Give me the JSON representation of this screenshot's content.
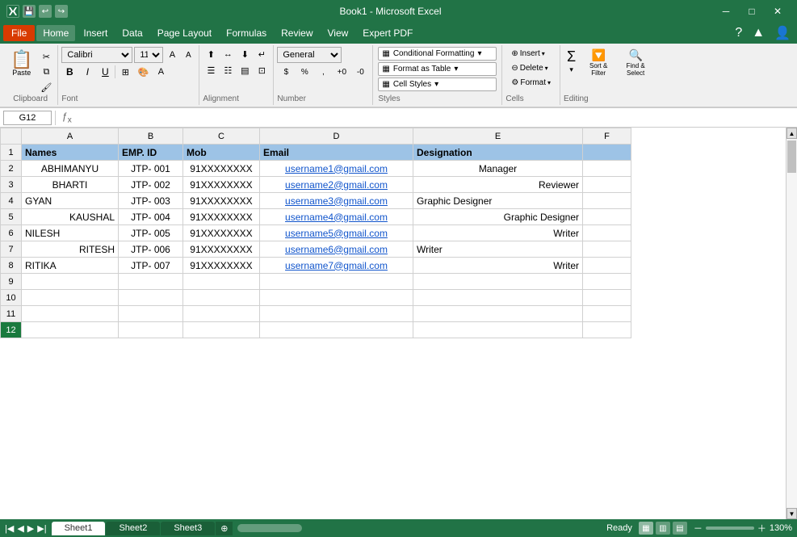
{
  "titleBar": {
    "title": "Book1 - Microsoft Excel",
    "minimize": "─",
    "maximize": "□",
    "close": "✕"
  },
  "menuBar": {
    "file": "File",
    "items": [
      "Home",
      "Insert",
      "Data",
      "Page Layout",
      "Formulas",
      "Review",
      "View",
      "Expert PDF"
    ]
  },
  "ribbon": {
    "clipboard": {
      "label": "Clipboard",
      "paste": "Paste",
      "cut": "✂",
      "copy": "⧉",
      "format_painter": "🖌"
    },
    "font": {
      "label": "Font",
      "name": "Calibri",
      "size": "11",
      "bold": "B",
      "italic": "I",
      "underline": "U",
      "increase": "A",
      "decrease": "A"
    },
    "alignment": {
      "label": "Alignment"
    },
    "number": {
      "label": "Number",
      "format": "General"
    },
    "styles": {
      "label": "Styles",
      "conditional": "Conditional Formatting",
      "format_as_table": "Format as Table",
      "cell_styles": "Cell Styles"
    },
    "cells": {
      "label": "Cells",
      "insert": "Insert",
      "delete": "Delete",
      "format": "Format"
    },
    "editing": {
      "label": "Editing",
      "autosum": "Σ",
      "sort_filter": "Sort & Filter",
      "find_select": "Find & Select"
    }
  },
  "formulaBar": {
    "nameBox": "G12",
    "formula": ""
  },
  "spreadsheet": {
    "columns": [
      "A",
      "B",
      "C",
      "D",
      "E",
      "F"
    ],
    "headers": [
      "Names",
      "EMP. ID",
      "Mob",
      "Email",
      "Designation",
      ""
    ],
    "rows": [
      {
        "num": 1,
        "isHeader": true,
        "cells": [
          "Names",
          "EMP. ID",
          "Mob",
          "Email",
          "Designation",
          ""
        ]
      },
      {
        "num": 2,
        "cells": [
          "ABHIMANYU",
          "JTP- 001",
          "91XXXXXXXX",
          "username1@gmail.com",
          "Manager",
          ""
        ]
      },
      {
        "num": 3,
        "cells": [
          "BHARTI",
          "JTP- 002",
          "91XXXXXXXX",
          "username2@gmail.com",
          "Reviewer",
          ""
        ]
      },
      {
        "num": 4,
        "cells": [
          "GYAN",
          "JTP- 003",
          "91XXXXXXXX",
          "username3@gmail.com",
          "Graphic Designer",
          ""
        ]
      },
      {
        "num": 5,
        "cells": [
          "KAUSHAL",
          "JTP- 004",
          "91XXXXXXXX",
          "username4@gmail.com",
          "Graphic Designer",
          ""
        ]
      },
      {
        "num": 6,
        "cells": [
          "NILESH",
          "JTP- 005",
          "91XXXXXXXX",
          "username5@gmail.com",
          "Writer",
          ""
        ]
      },
      {
        "num": 7,
        "cells": [
          "RITESH",
          "JTP- 006",
          "91XXXXXXXX",
          "username6@gmail.com",
          "Writer",
          ""
        ]
      },
      {
        "num": 8,
        "cells": [
          "RITIKA",
          "JTP- 007",
          "91XXXXXXXX",
          "username7@gmail.com",
          "Writer",
          ""
        ]
      },
      {
        "num": 9,
        "cells": [
          "",
          "",
          "",
          "",
          "",
          ""
        ]
      },
      {
        "num": 10,
        "cells": [
          "",
          "",
          "",
          "",
          "",
          ""
        ]
      },
      {
        "num": 11,
        "cells": [
          "",
          "",
          "",
          "",
          "",
          ""
        ]
      },
      {
        "num": 12,
        "cells": [
          "",
          "",
          "",
          "",
          "",
          ""
        ],
        "isActive": true
      }
    ]
  },
  "sheetTabs": [
    "Sheet1",
    "Sheet2",
    "Sheet3"
  ],
  "statusBar": {
    "ready": "Ready",
    "zoom": "130%"
  },
  "colAlignments": {
    "A": [
      "bold",
      "center",
      "center",
      "center",
      "right",
      "left",
      "right",
      "left"
    ],
    "B": [
      "bold",
      "center",
      "center",
      "center",
      "center",
      "center",
      "center",
      "center"
    ],
    "C": [
      "bold",
      "center",
      "center",
      "center",
      "center",
      "center",
      "center",
      "center"
    ],
    "D": [
      "bold",
      "center",
      "center",
      "center",
      "center",
      "center",
      "center",
      "center"
    ],
    "E": [
      "bold",
      "left",
      "right",
      "left",
      "right",
      "right",
      "left",
      "right"
    ]
  }
}
